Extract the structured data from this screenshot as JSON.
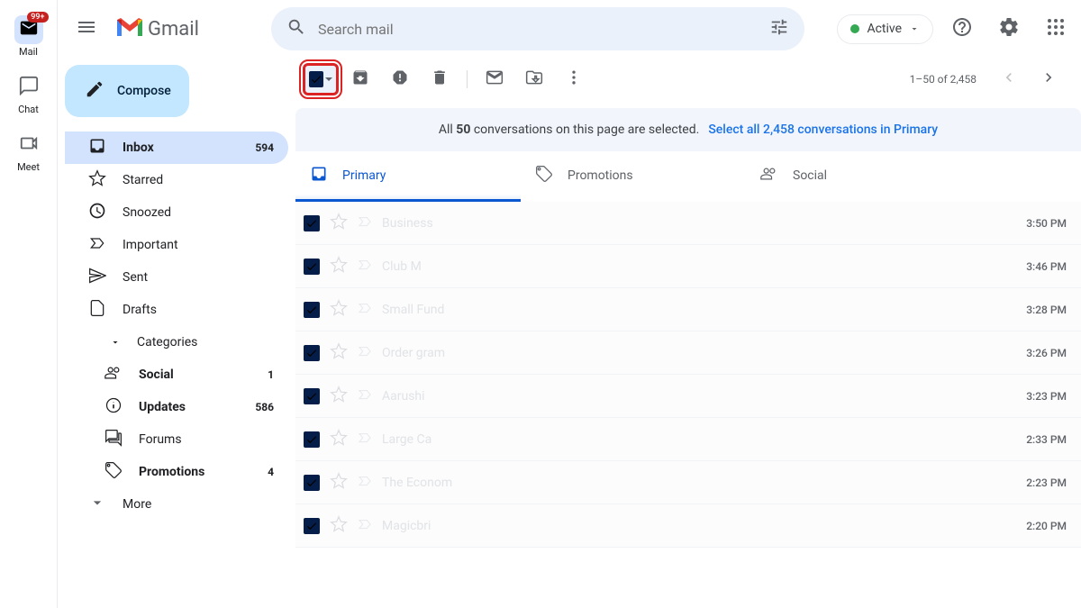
{
  "app": {
    "name": "Gmail"
  },
  "search": {
    "placeholder": "Search mail"
  },
  "status": {
    "label": "Active"
  },
  "nav_rail": {
    "badge": "99+",
    "items": [
      {
        "label": "Mail"
      },
      {
        "label": "Chat"
      },
      {
        "label": "Meet"
      }
    ]
  },
  "compose": {
    "label": "Compose"
  },
  "sidebar": [
    {
      "label": "Inbox",
      "count": "594",
      "active": true,
      "bold": true,
      "icon": "inbox"
    },
    {
      "label": "Starred",
      "icon": "star"
    },
    {
      "label": "Snoozed",
      "icon": "clock"
    },
    {
      "label": "Important",
      "icon": "important"
    },
    {
      "label": "Sent",
      "icon": "send"
    },
    {
      "label": "Drafts",
      "icon": "file"
    },
    {
      "label": "Categories",
      "icon": "expand",
      "expandable": true
    }
  ],
  "sidebar_sub": [
    {
      "label": "Social",
      "count": "1",
      "bold": true,
      "icon": "people"
    },
    {
      "label": "Updates",
      "count": "586",
      "bold": true,
      "icon": "info"
    },
    {
      "label": "Forums",
      "icon": "forum"
    },
    {
      "label": "Promotions",
      "count": "4",
      "bold": true,
      "icon": "tag"
    }
  ],
  "sidebar_more": {
    "label": "More"
  },
  "toolbar": {
    "page_info": "1–50 of 2,458"
  },
  "selection": {
    "text_pre": "All ",
    "text_bold": "50",
    "text_post": " conversations on this page are selected.",
    "link": "Select all 2,458 conversations in Primary"
  },
  "tabs": [
    {
      "label": "Primary",
      "active": true
    },
    {
      "label": "Promotions"
    },
    {
      "label": "Social"
    }
  ],
  "emails": [
    {
      "sender": "Business",
      "time": "3:50 PM"
    },
    {
      "sender": "Club M",
      "time": "3:46 PM"
    },
    {
      "sender": "Small Fund",
      "time": "3:28 PM"
    },
    {
      "sender": "Order gram",
      "time": "3:26 PM"
    },
    {
      "sender": "Aarushi",
      "time": "3:23 PM"
    },
    {
      "sender": "Large Ca",
      "time": "2:33 PM"
    },
    {
      "sender": "The Econom",
      "time": "2:23 PM"
    },
    {
      "sender": "Magicbri",
      "time": "2:20 PM"
    }
  ]
}
